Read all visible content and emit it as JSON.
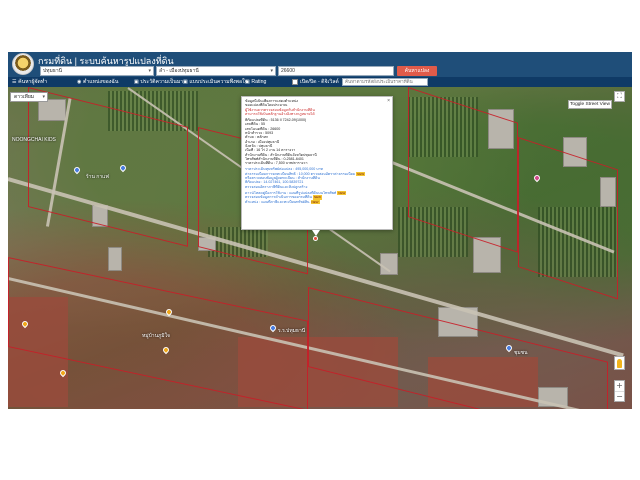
{
  "header": {
    "title": "กรมที่ดิน | ระบบค้นหารูปแปลงที่ดิน"
  },
  "search": {
    "province": "ปทุมธานี",
    "district": "ลำ - เมืองปทุมธานี",
    "parcel_no": "26600",
    "button": "ค้นหาแปลง"
  },
  "menu": {
    "items": [
      "ค้นหาผู้จัดทำ",
      "ตำแหน่งของฉัน",
      "ประวัติความเป็นมา",
      "แบบประเมินความพึงพอใจ",
      "Rating",
      "เปิด/ปิด - ดิจิเวิลด์"
    ],
    "search_placeholder": "ค้นหาตามรหัสผังประเมินราคาที่ดิน"
  },
  "map": {
    "type_label": "ดาวเทียม",
    "toggle_street_view": "Toggle Street View",
    "labels": [
      "NOONGCHAI KIDS",
      "ร้าน กาแฟ",
      "หมู่บ้านภูมิใจ",
      "ร.ร.ปทุมธานี",
      "ชุมชน"
    ]
  },
  "popup": {
    "header_lines": [
      "ข้อมูลนี้เป็นเพียงการแสดงตำแหน่ง",
      "ของแปลงที่ดินโดยประมาณ",
      "ผู้ใช้งานควรตรวจสอบข้อมูลกับสำนักงานที่ดิน",
      "สามารถใช้เป็นหลักฐานอ้างอิงทางกฎหมายได้"
    ],
    "detail_lines": [
      "พิกัดแปลงที่ดิน : 5136 II 7242-09(1000)",
      "เลขที่ดิน : 55",
      "เลขโฉนดที่ดิน : 26600",
      "หน้าสำรวจ : 5093",
      "ตำบล : หลักหก",
      "อำเภอ : เมืองปทุมธานี",
      "จังหวัด : ปทุมธานี",
      "เนื้อที่ : 16 ไร่ 2 งาน 14 ตารางวา",
      "สำนักงานที่ดิน : สำนักงานที่ดินจังหวัดปทุมธานี",
      "โทรศัพท์สำนักงานที่ดิน : 0-2581-6401",
      "ราคาประเมินที่ดิน : 7,500 บาท/ตารางวา"
    ],
    "link_lines": [
      "ราคาประเมินทุนทรัพย์ต่อแปลง : 495,000,000 บาท",
      "ค่าธรรมเนียมการจดทะเบียนสิทธิ : 10,000 ตรวจสอบอัตราค่าธรรมเนียม",
      "หรือตรวจสอบข้อมูลผู้จดทะเบียน : สำนักงานที่ดิน",
      "พิกัดแปลง : 14.027461, 100.5839721",
      "ตรวจสอบอัตราภาษีที่ดินและสิ่งปลูกสร้าง"
    ],
    "footer_lines": [
      "ดาวน์โหลดคู่มือการใช้งาน : แผนที่รูปแปลงที่ดินบนโทรศัพท์",
      "ตรวจสอบข้อมูลการดำเนินการของกรมที่ดิน",
      "ตำแหน่ง : แผนที่ภาษีและทะเบียนทรัพย์สิน"
    ],
    "new_badge": "NEW",
    "close": "×"
  },
  "colors": {
    "header_bg": "#1f4e79",
    "menu_bg": "#0f3a66",
    "search_btn": "#e05b4a",
    "parcel_line": "#c81e28"
  }
}
